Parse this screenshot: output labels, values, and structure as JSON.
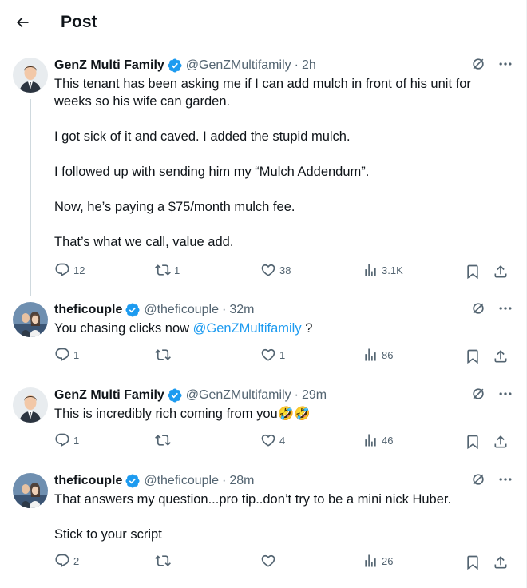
{
  "header": {
    "title": "Post",
    "back_icon": "back-arrow-icon"
  },
  "colors": {
    "accent": "#1d9bf0",
    "text": "#0f1419",
    "muted": "#536471"
  },
  "tweets": [
    {
      "name": "GenZ Multi Family",
      "handle": "@GenZMultifamily",
      "time": "2h",
      "verified": true,
      "paragraphs": [
        "This tenant has been asking me if I can add mulch in front of his unit for weeks so his wife can garden.",
        "I got sick of it and caved. I added the stupid mulch.",
        "I followed up with sending him my “Mulch Addendum”.",
        "Now, he’s paying a $75/month mulch fee.",
        "That’s what we call, value add."
      ],
      "replies": "12",
      "reposts": "1",
      "likes": "38",
      "views": "3.1K"
    },
    {
      "name": "theficouple",
      "handle": "@theficouple",
      "time": "32m",
      "verified": true,
      "text_before": "You chasing clicks now ",
      "mention": "@GenZMultifamily",
      "text_after": " ?",
      "replies": "1",
      "reposts": "",
      "likes": "1",
      "views": "86"
    },
    {
      "name": "GenZ Multi Family",
      "handle": "@GenZMultifamily",
      "time": "29m",
      "verified": true,
      "text": "This is incredibly rich coming from you🤣🤣",
      "replies": "1",
      "reposts": "",
      "likes": "4",
      "views": "46"
    },
    {
      "name": "theficouple",
      "handle": "@theficouple",
      "time": "28m",
      "verified": true,
      "paragraphs": [
        "That answers my question...pro tip..don’t try to be a mini nick Huber.",
        "Stick to your script"
      ],
      "replies": "2",
      "reposts": "",
      "likes": "",
      "views": "26"
    }
  ]
}
